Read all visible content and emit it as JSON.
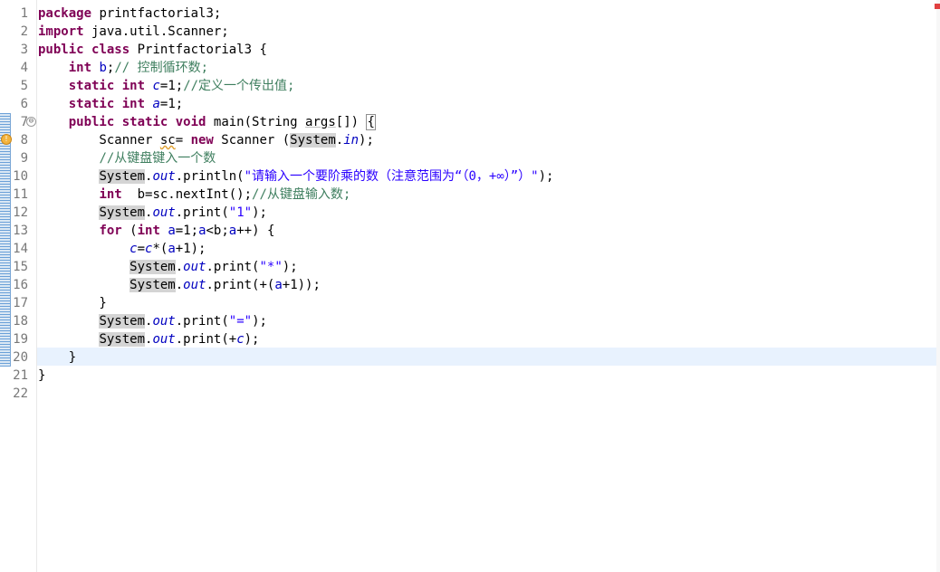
{
  "editor": {
    "line_numbers": [
      "1",
      "2",
      "3",
      "4",
      "5",
      "6",
      "7",
      "8",
      "9",
      "10",
      "11",
      "12",
      "13",
      "14",
      "15",
      "16",
      "17",
      "18",
      "19",
      "20",
      "21",
      "22"
    ],
    "current_line": "20",
    "lines": [
      [
        {
          "t": "package",
          "c": "kw"
        },
        {
          "t": " printfactorial3;"
        }
      ],
      [
        {
          "t": "import",
          "c": "kw"
        },
        {
          "t": " java.util.Scanner;"
        }
      ],
      [
        {
          "t": "public",
          "c": "kw"
        },
        {
          "t": " "
        },
        {
          "t": "class",
          "c": "kw"
        },
        {
          "t": " Printfactorial3 {"
        }
      ],
      [
        {
          "t": "    "
        },
        {
          "t": "int",
          "c": "kw"
        },
        {
          "t": " "
        },
        {
          "t": "b",
          "c": "fa"
        },
        {
          "t": ";"
        },
        {
          "t": "// 控制循环数;",
          "c": "cm"
        }
      ],
      [
        {
          "t": "    "
        },
        {
          "t": "static",
          "c": "kw"
        },
        {
          "t": " "
        },
        {
          "t": "int",
          "c": "kw"
        },
        {
          "t": " "
        },
        {
          "t": "c",
          "c": "fi"
        },
        {
          "t": "=1;"
        },
        {
          "t": "//定义一个传出值;",
          "c": "cm"
        }
      ],
      [
        {
          "t": "    "
        },
        {
          "t": "static",
          "c": "kw"
        },
        {
          "t": " "
        },
        {
          "t": "int",
          "c": "kw"
        },
        {
          "t": " "
        },
        {
          "t": "a",
          "c": "fi"
        },
        {
          "t": "=1;"
        }
      ],
      [
        {
          "t": "    "
        },
        {
          "t": "public",
          "c": "kw"
        },
        {
          "t": " "
        },
        {
          "t": "static",
          "c": "kw"
        },
        {
          "t": " "
        },
        {
          "t": "void",
          "c": "kw"
        },
        {
          "t": " main(String "
        },
        {
          "t": "args",
          "c": "gl"
        },
        {
          "t": "[]) "
        },
        {
          "t": "{",
          "c": "bm"
        }
      ],
      [
        {
          "t": "        Scanner "
        },
        {
          "t": "sc",
          "c": "ul"
        },
        {
          "t": "= "
        },
        {
          "t": "new",
          "c": "kw"
        },
        {
          "t": " Scanner ("
        },
        {
          "t": "System",
          "c": "hl"
        },
        {
          "t": "."
        },
        {
          "t": "in",
          "c": "fi"
        },
        {
          "t": ");"
        }
      ],
      [
        {
          "t": "        "
        },
        {
          "t": "//从键盘键入一个数",
          "c": "cm"
        }
      ],
      [
        {
          "t": "        "
        },
        {
          "t": "System",
          "c": "hl"
        },
        {
          "t": "."
        },
        {
          "t": "out",
          "c": "fi"
        },
        {
          "t": ".println("
        },
        {
          "t": "\"请输入一个要阶乘的数（注意范围为“（0，+∞）”）\"",
          "c": "st"
        },
        {
          "t": ");"
        }
      ],
      [
        {
          "t": "        "
        },
        {
          "t": "int",
          "c": "kw"
        },
        {
          "t": "  b=sc.nextInt();"
        },
        {
          "t": "//从键盘输入数;",
          "c": "cm"
        }
      ],
      [
        {
          "t": "        "
        },
        {
          "t": "System",
          "c": "hl"
        },
        {
          "t": "."
        },
        {
          "t": "out",
          "c": "fi"
        },
        {
          "t": ".print("
        },
        {
          "t": "\"1\"",
          "c": "st"
        },
        {
          "t": ");"
        }
      ],
      [
        {
          "t": "        "
        },
        {
          "t": "for",
          "c": "kw"
        },
        {
          "t": " ("
        },
        {
          "t": "int",
          "c": "kw"
        },
        {
          "t": " "
        },
        {
          "t": "a",
          "c": "fa"
        },
        {
          "t": "=1;"
        },
        {
          "t": "a",
          "c": "fa"
        },
        {
          "t": "<b;"
        },
        {
          "t": "a",
          "c": "fa"
        },
        {
          "t": "++) {"
        }
      ],
      [
        {
          "t": "            "
        },
        {
          "t": "c",
          "c": "fi"
        },
        {
          "t": "="
        },
        {
          "t": "c",
          "c": "fi"
        },
        {
          "t": "*("
        },
        {
          "t": "a",
          "c": "fa"
        },
        {
          "t": "+1);"
        }
      ],
      [
        {
          "t": "            "
        },
        {
          "t": "System",
          "c": "hl"
        },
        {
          "t": "."
        },
        {
          "t": "out",
          "c": "fi"
        },
        {
          "t": ".print("
        },
        {
          "t": "\"*\"",
          "c": "st"
        },
        {
          "t": ");"
        }
      ],
      [
        {
          "t": "            "
        },
        {
          "t": "System",
          "c": "hl"
        },
        {
          "t": "."
        },
        {
          "t": "out",
          "c": "fi"
        },
        {
          "t": ".print(+("
        },
        {
          "t": "a",
          "c": "fa"
        },
        {
          "t": "+1));"
        }
      ],
      [
        {
          "t": "        }"
        }
      ],
      [
        {
          "t": "        "
        },
        {
          "t": "System",
          "c": "hl"
        },
        {
          "t": "."
        },
        {
          "t": "out",
          "c": "fi"
        },
        {
          "t": ".print("
        },
        {
          "t": "\"=\"",
          "c": "st"
        },
        {
          "t": ");"
        }
      ],
      [
        {
          "t": "        "
        },
        {
          "t": "System",
          "c": "hl"
        },
        {
          "t": "."
        },
        {
          "t": "out",
          "c": "fi"
        },
        {
          "t": ".print(+"
        },
        {
          "t": "c",
          "c": "fi"
        },
        {
          "t": ");"
        }
      ],
      [
        {
          "t": "    }"
        }
      ],
      [
        {
          "t": "}"
        }
      ],
      []
    ],
    "markers": {
      "fold_glyph": "⊖",
      "warning_glyph": "!"
    },
    "colors": {
      "keyword": "#7f0055",
      "comment": "#3f7f5f",
      "string": "#2a00ff",
      "field": "#0000c0",
      "current_line_bg": "#e8f2fe",
      "occurrence_highlight": "#d4d4d4"
    }
  }
}
